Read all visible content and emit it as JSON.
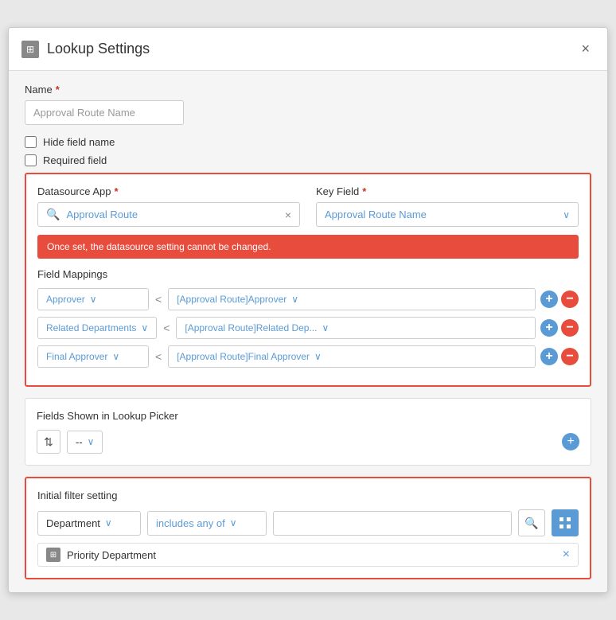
{
  "dialog": {
    "title": "Lookup Settings",
    "close_label": "×",
    "title_icon": "⊞"
  },
  "name_section": {
    "label": "Name",
    "required": true,
    "input_value": "Approval Route Name"
  },
  "checkboxes": {
    "hide_field_name": {
      "label": "Hide field name",
      "checked": false
    },
    "required_field": {
      "label": "Required field",
      "checked": false
    }
  },
  "datasource_section": {
    "datasource_label": "Datasource App",
    "required": true,
    "search_value": "Approval Route",
    "key_field_label": "Key Field",
    "key_field_value": "Approval Route Name",
    "alert_message": "Once set, the datasource setting cannot be changed.",
    "field_mappings_label": "Field Mappings",
    "mappings": [
      {
        "left": "Approver",
        "right": "[Approval Route]Approver"
      },
      {
        "left": "Related Departments",
        "right": "[Approval Route]Related Dep..."
      },
      {
        "left": "Final Approver",
        "right": "[Approval Route]Final Approver"
      }
    ]
  },
  "fields_shown_section": {
    "label": "Fields Shown in Lookup Picker",
    "dash_value": "--"
  },
  "filter_section": {
    "label": "Initial filter setting",
    "filter_field": "Department",
    "filter_condition": "includes any of",
    "filter_value": "",
    "search_placeholder": ""
  },
  "priority_tag": {
    "text": "Priority Department",
    "icon": "⊞"
  },
  "buttons": {
    "add": "+",
    "remove": "−",
    "chevron": "∨",
    "arrow_left": "<",
    "search": "🔍",
    "grid": "⊞",
    "up_down": "⇅",
    "close_x": "×"
  }
}
